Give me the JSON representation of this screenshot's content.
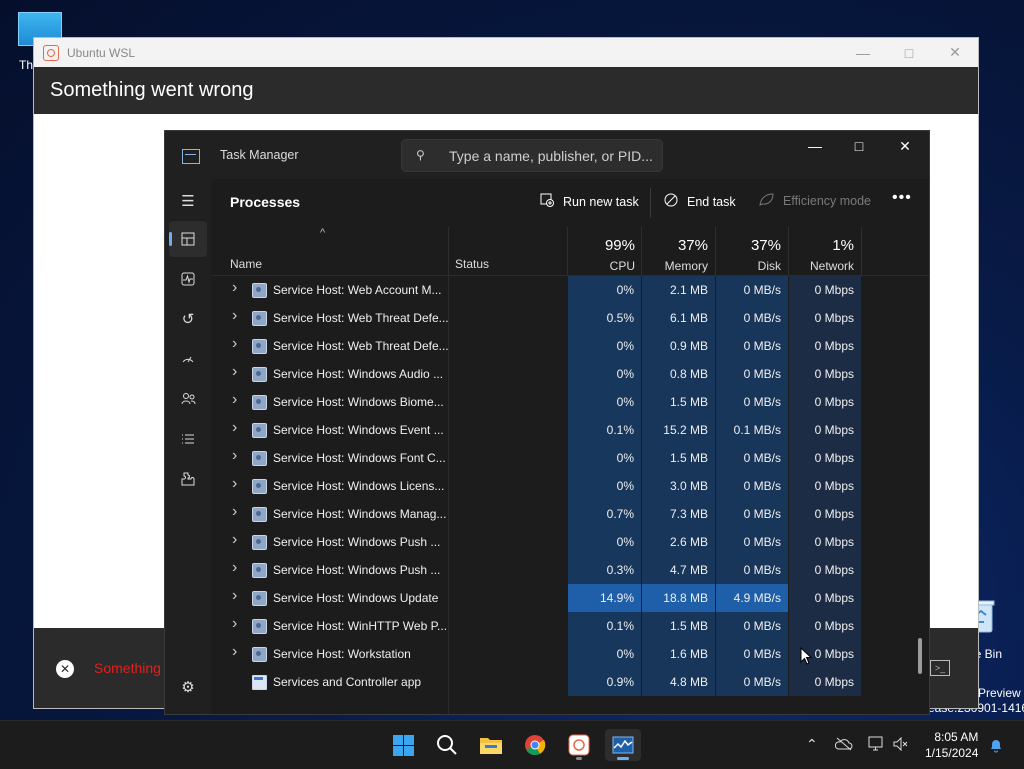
{
  "desktop": {
    "icon_label": "Th",
    "recycle_label": "le Bin",
    "watermark_line1": "Preview",
    "watermark_line2": "ease.230901-1416"
  },
  "ubuntu": {
    "title": "Ubuntu WSL",
    "header": "Something went wrong",
    "footer_error": "Something"
  },
  "taskmgr": {
    "title": "Task Manager",
    "search_placeholder": "Type a name, publisher, or PID...",
    "heading": "Processes",
    "toolbar": {
      "run_new_task": "Run new task",
      "end_task": "End task",
      "efficiency_mode": "Efficiency mode",
      "more": "•••"
    },
    "columns": {
      "sort_indicator": "^",
      "name": "Name",
      "status": "Status",
      "cpu_pct": "99%",
      "cpu": "CPU",
      "mem_pct": "37%",
      "mem": "Memory",
      "disk_pct": "37%",
      "disk": "Disk",
      "net_pct": "1%",
      "net": "Network"
    },
    "rows": [
      {
        "name": "Service Host: Web Account M...",
        "cpu": "0%",
        "mem": "2.1 MB",
        "disk": "0 MB/s",
        "net": "0 Mbps"
      },
      {
        "name": "Service Host: Web Threat Defe...",
        "cpu": "0.5%",
        "mem": "6.1 MB",
        "disk": "0 MB/s",
        "net": "0 Mbps"
      },
      {
        "name": "Service Host: Web Threat Defe...",
        "cpu": "0%",
        "mem": "0.9 MB",
        "disk": "0 MB/s",
        "net": "0 Mbps"
      },
      {
        "name": "Service Host: Windows Audio ...",
        "cpu": "0%",
        "mem": "0.8 MB",
        "disk": "0 MB/s",
        "net": "0 Mbps"
      },
      {
        "name": "Service Host: Windows Biome...",
        "cpu": "0%",
        "mem": "1.5 MB",
        "disk": "0 MB/s",
        "net": "0 Mbps"
      },
      {
        "name": "Service Host: Windows Event ...",
        "cpu": "0.1%",
        "mem": "15.2 MB",
        "disk": "0.1 MB/s",
        "net": "0 Mbps"
      },
      {
        "name": "Service Host: Windows Font C...",
        "cpu": "0%",
        "mem": "1.5 MB",
        "disk": "0 MB/s",
        "net": "0 Mbps"
      },
      {
        "name": "Service Host: Windows Licens...",
        "cpu": "0%",
        "mem": "3.0 MB",
        "disk": "0 MB/s",
        "net": "0 Mbps"
      },
      {
        "name": "Service Host: Windows Manag...",
        "cpu": "0.7%",
        "mem": "7.3 MB",
        "disk": "0 MB/s",
        "net": "0 Mbps"
      },
      {
        "name": "Service Host: Windows Push ...",
        "cpu": "0%",
        "mem": "2.6 MB",
        "disk": "0 MB/s",
        "net": "0 Mbps"
      },
      {
        "name": "Service Host: Windows Push ...",
        "cpu": "0.3%",
        "mem": "4.7 MB",
        "disk": "0 MB/s",
        "net": "0 Mbps"
      },
      {
        "name": "Service Host: Windows Update",
        "cpu": "14.9%",
        "mem": "18.8 MB",
        "disk": "4.9 MB/s",
        "net": "0 Mbps"
      },
      {
        "name": "Service Host: WinHTTP Web P...",
        "cpu": "0.1%",
        "mem": "1.5 MB",
        "disk": "0 MB/s",
        "net": "0 Mbps"
      },
      {
        "name": "Service Host: Workstation",
        "cpu": "0%",
        "mem": "1.6 MB",
        "disk": "0 MB/s",
        "net": "0 Mbps"
      },
      {
        "name": "Services and Controller app",
        "cpu": "0.9%",
        "mem": "4.8 MB",
        "disk": "0 MB/s",
        "net": "0 Mbps"
      }
    ]
  },
  "taskbar": {
    "time": "8:05 AM",
    "date": "1/15/2024"
  },
  "colors": {
    "accent": "#6cb0f3",
    "heat_hot": "#1f5ea8",
    "error_red": "#e0211b"
  }
}
